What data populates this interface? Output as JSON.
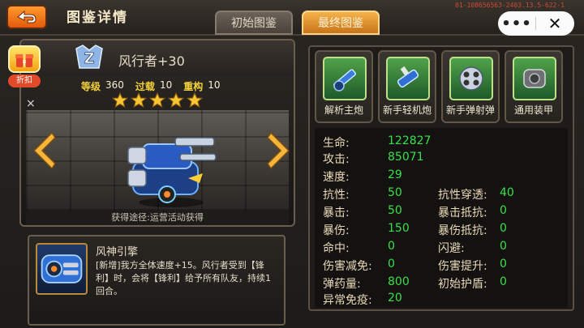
{
  "header": {
    "title": "图鉴详情",
    "build_id": "01-108656563-2403.13.5-622-1",
    "tabs": [
      {
        "label": "初始图鉴",
        "selected": false
      },
      {
        "label": "最终图鉴",
        "selected": true
      }
    ],
    "capsule_more": "•••",
    "capsule_close": "✕"
  },
  "unit": {
    "name": "风行者+30",
    "rank_letter": "Z",
    "stats": [
      {
        "label": "等级",
        "value": "360"
      },
      {
        "label": "过载",
        "value": "10"
      },
      {
        "label": "重构",
        "value": "10"
      }
    ],
    "star_count": 5,
    "source": "获得途径:运营活动获得"
  },
  "promo": {
    "label": "折扣",
    "icon": "gift-icon",
    "dismiss": "×"
  },
  "skill": {
    "name": "风神引擎",
    "description": "[新增]我方全体速度+15。风行者受到【锋利】时，会将【锋利】给予所有队友，持续1回合。"
  },
  "equipment": [
    {
      "name": "解析主炮",
      "icon": "main-cannon-icon"
    },
    {
      "name": "新手轻机炮",
      "icon": "light-gun-icon"
    },
    {
      "name": "新手弹射弹",
      "icon": "missile-pod-icon"
    },
    {
      "name": "通用装甲",
      "icon": "armor-icon"
    }
  ],
  "attributes_left": [
    {
      "label": "生命:",
      "value": "122827"
    },
    {
      "label": "攻击:",
      "value": "85071"
    },
    {
      "label": "速度:",
      "value": "29"
    },
    {
      "label": "抗性:",
      "value": "50"
    },
    {
      "label": "暴击:",
      "value": "50"
    },
    {
      "label": "暴伤:",
      "value": "150"
    },
    {
      "label": "命中:",
      "value": "0"
    },
    {
      "label": "伤害减免:",
      "value": "0"
    },
    {
      "label": "弹药量:",
      "value": "800"
    },
    {
      "label": "异常免疫:",
      "value": "20"
    }
  ],
  "attributes_right": [
    {
      "label": "抗性穿透:",
      "value": "40"
    },
    {
      "label": "暴击抵抗:",
      "value": "0"
    },
    {
      "label": "暴伤抵抗:",
      "value": "0"
    },
    {
      "label": "闪避:",
      "value": "0"
    },
    {
      "label": "伤害提升:",
      "value": "0"
    },
    {
      "label": "初始护盾:",
      "value": "0"
    }
  ],
  "colors": {
    "accent": "#f6b24a",
    "value_green": "#39e04a",
    "star_gold": "#f7c531"
  }
}
